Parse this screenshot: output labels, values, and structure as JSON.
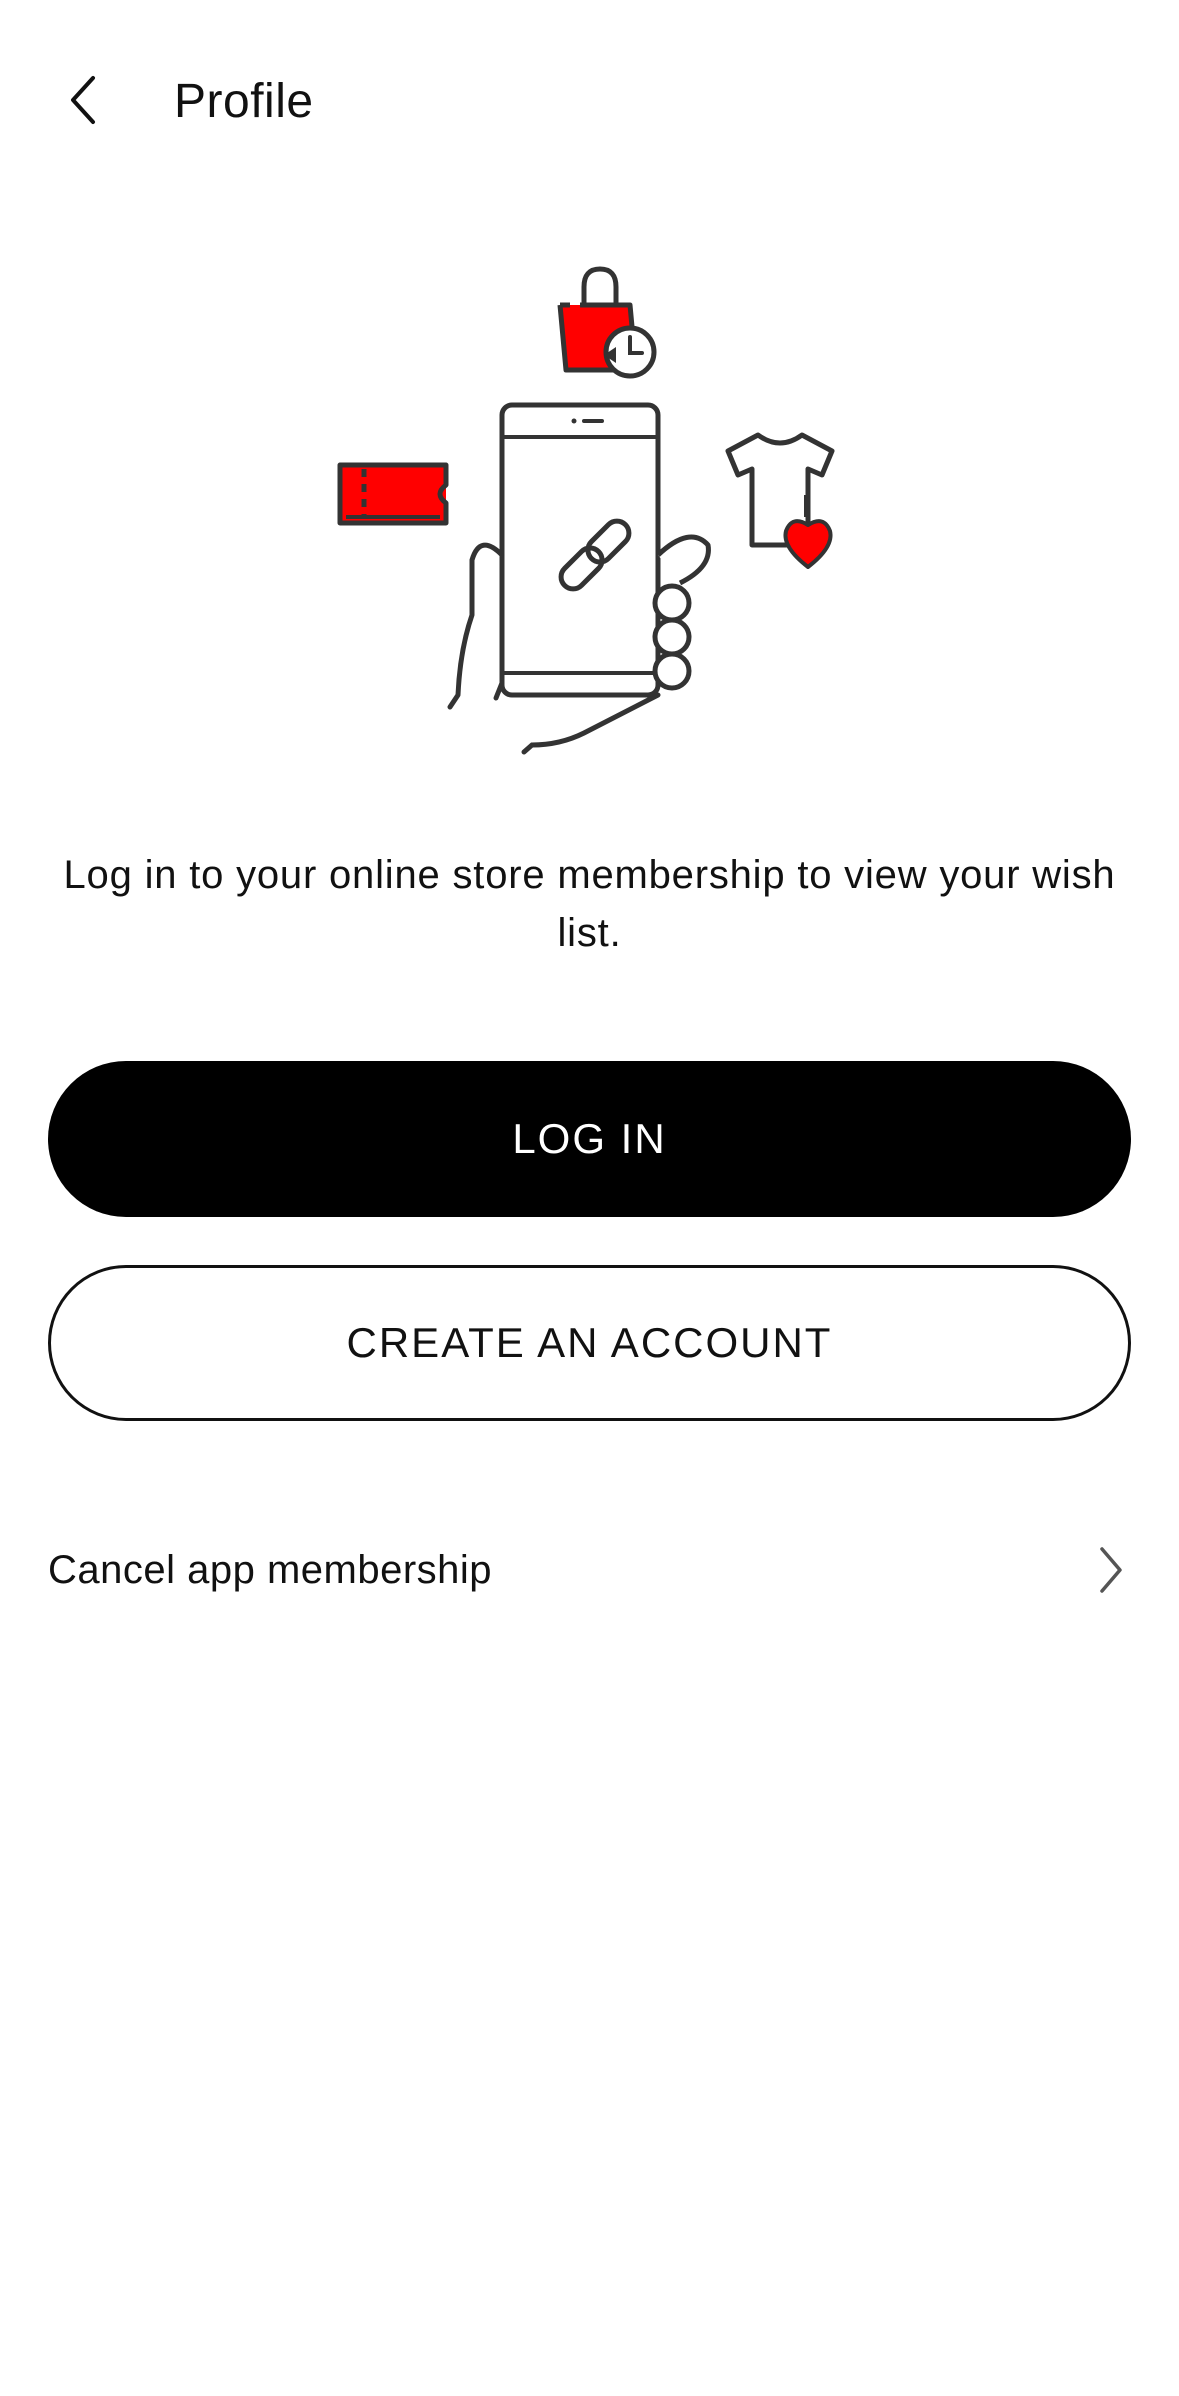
{
  "header": {
    "back_icon": "chevron-left-icon",
    "title": "Profile"
  },
  "illustration": {
    "accent_color": "#ff0000",
    "line_color": "#333333",
    "icons": [
      "shopping-bag-clock-icon",
      "ticket-icon",
      "phone-link-hand-icon",
      "tshirt-heart-icon"
    ]
  },
  "message": "Log in to your online store membership to view your wish list.",
  "buttons": {
    "login_label": "LOG IN",
    "create_label": "CREATE AN ACCOUNT"
  },
  "cancel": {
    "label": "Cancel app membership",
    "chevron_icon": "chevron-right-icon"
  },
  "colors": {
    "primary": "#000000",
    "accent": "#ff0000",
    "background": "#ffffff"
  }
}
